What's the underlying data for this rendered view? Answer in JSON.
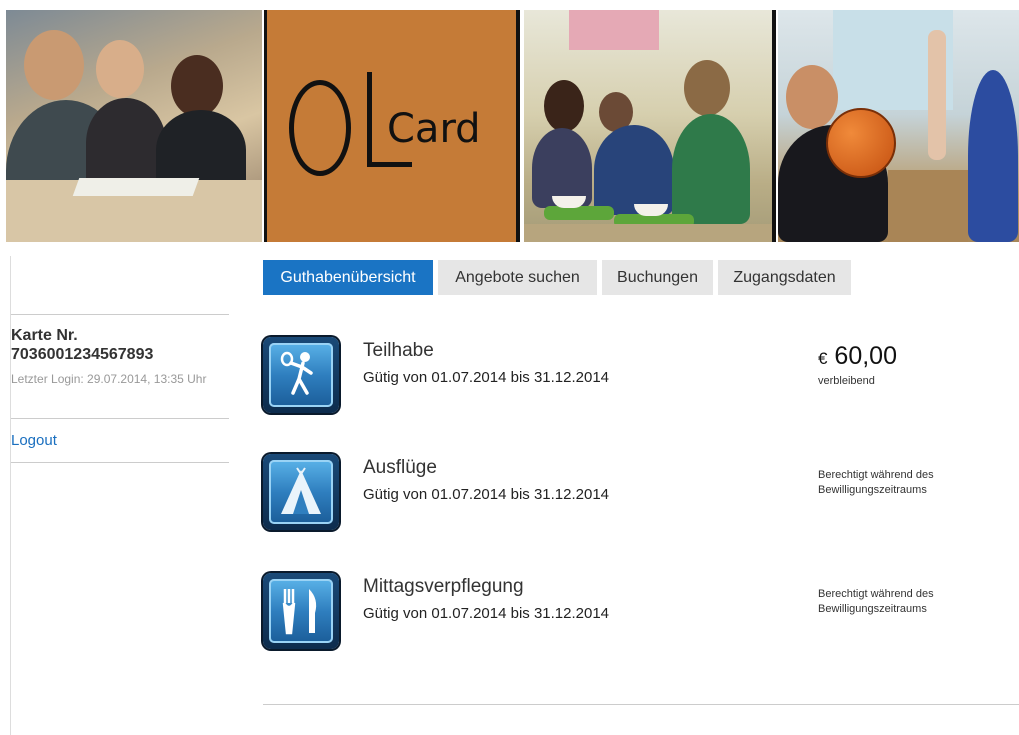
{
  "header": {
    "logo_text": "Card",
    "logo_letters": "OL"
  },
  "tabs": [
    {
      "label": "Guthabenübersicht",
      "active": true
    },
    {
      "label": "Angebote suchen",
      "active": false
    },
    {
      "label": "Buchungen",
      "active": false
    },
    {
      "label": "Zugangsdaten",
      "active": false
    }
  ],
  "sidebar": {
    "card_label": "Karte Nr.",
    "card_number": "7036001234567893",
    "last_login": "Letzter Login: 29.07.2014, 13:35 Uhr",
    "logout_label": "Logout"
  },
  "items": [
    {
      "title": "Teilhabe",
      "validity": "Gütig von 01.07.2014 bis 31.12.2014",
      "currency": "€",
      "amount": "60,00",
      "amount_note": "verbleibend",
      "icon": "tennis-player-icon"
    },
    {
      "title": "Ausflüge",
      "validity": "Gütig von 01.07.2014 bis 31.12.2014",
      "note": "Berechtigt während des Bewilligungszeitraums",
      "icon": "tent-icon"
    },
    {
      "title": "Mittagsverpflegung",
      "validity": "Gütig von 01.07.2014 bis 31.12.2014",
      "note": "Berechtigt während des Bewilligungszeitraums",
      "icon": "fork-knife-icon"
    }
  ],
  "colors": {
    "accent": "#1a74c4",
    "logo_bg": "#c57b37",
    "link": "#1a6fbf"
  }
}
